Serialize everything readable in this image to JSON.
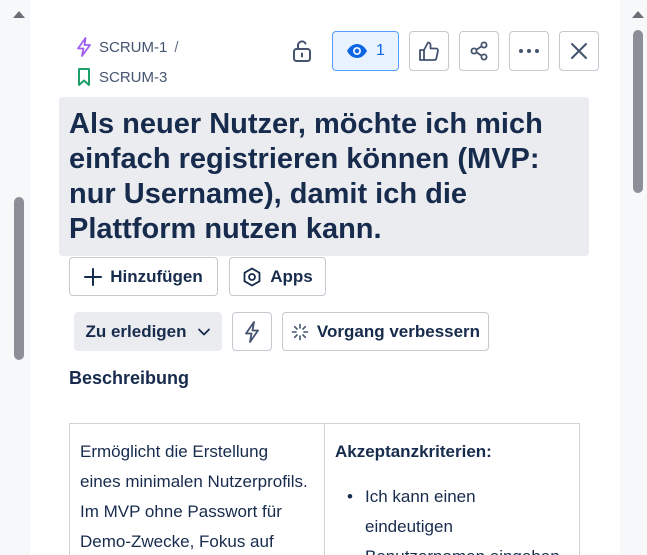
{
  "breadcrumb": {
    "parent": {
      "label": "SCRUM-1",
      "separator": "/",
      "icon": "epic-lightning-icon",
      "color": "#a05ff0"
    },
    "current": {
      "label": "SCRUM-3",
      "icon": "story-bookmark-icon",
      "color": "#22a06b"
    }
  },
  "toolbar": {
    "lock_icon": "unlock-icon",
    "watch": {
      "icon": "eye-icon",
      "count": "1",
      "color": "#0c66e4"
    },
    "like_icon": "thumbs-up-icon",
    "share_icon": "share-icon",
    "more_icon": "more-icon",
    "close_icon": "close-icon"
  },
  "issue": {
    "title": "Als neuer Nutzer, möchte ich mich einfach registrieren können (MVP: nur Username), damit ich die Plattform nutzen kann."
  },
  "actions": {
    "add_label": "Hinzufügen",
    "apps_label": "Apps",
    "status_label": "Zu erledigen",
    "automation_icon": "lightning-icon",
    "improve_label": "Vorgang verbessern"
  },
  "description": {
    "heading": "Beschreibung",
    "left_text_lines": [
      "Ermöglicht die Erstellung",
      "eines minimalen Nutzerprofils.",
      "Im MVP ohne Passwort für",
      "Demo-Zwecke, Fokus auf"
    ],
    "criteria_title": "Akzeptanzkriterien:",
    "criteria_items_lines": [
      "Ich kann einen",
      "eindeutigen",
      "Benutzernamen eingeben"
    ]
  }
}
